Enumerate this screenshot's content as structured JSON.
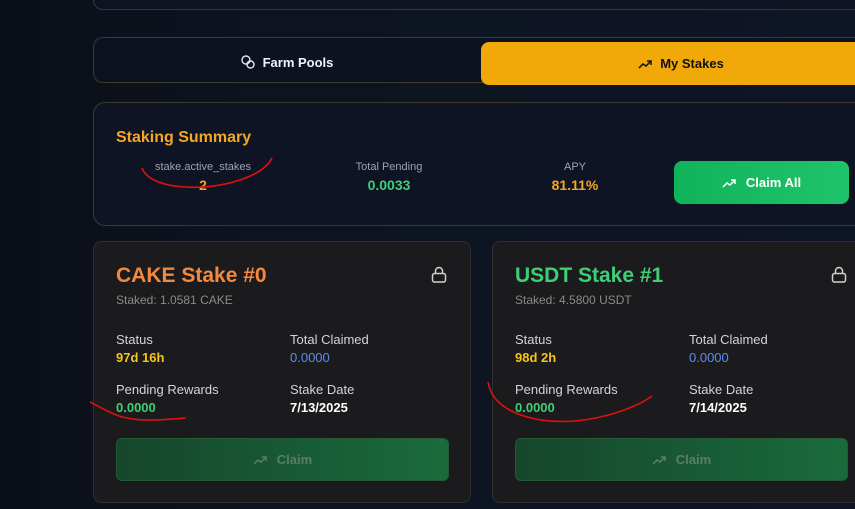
{
  "tabs": {
    "farm_pools": "Farm Pools",
    "my_stakes": "My Stakes"
  },
  "summary": {
    "title": "Staking Summary",
    "active_label": "stake.active_stakes",
    "active_value": "2",
    "pending_label": "Total Pending",
    "pending_value": "0.0033",
    "apy_label": "APY",
    "apy_value": "81.11%",
    "claim_all": "Claim All"
  },
  "stakes": [
    {
      "title": "CAKE Stake #0",
      "title_color": "#f4883c",
      "staked": "Staked: 1.0581 CAKE",
      "status_label": "Status",
      "status_value": "97d 16h",
      "claimed_label": "Total Claimed",
      "claimed_value": "0.0000",
      "pending_label": "Pending Rewards",
      "pending_value": "0.0000",
      "date_label": "Stake Date",
      "date_value": "7/13/2025",
      "claim": "Claim"
    },
    {
      "title": "USDT Stake #1",
      "title_color": "#3ecf76",
      "staked": "Staked: 4.5800 USDT",
      "status_label": "Status",
      "status_value": "98d 2h",
      "claimed_label": "Total Claimed",
      "claimed_value": "0.0000",
      "pending_label": "Pending Rewards",
      "pending_value": "0.0000",
      "date_label": "Stake Date",
      "date_value": "7/14/2025",
      "claim": "Claim"
    }
  ],
  "colors": {
    "accent": "#f0a909",
    "green": "#3ecf76",
    "blue": "#5b8def",
    "yellow": "#f5c518",
    "annotation": "#e01010"
  }
}
